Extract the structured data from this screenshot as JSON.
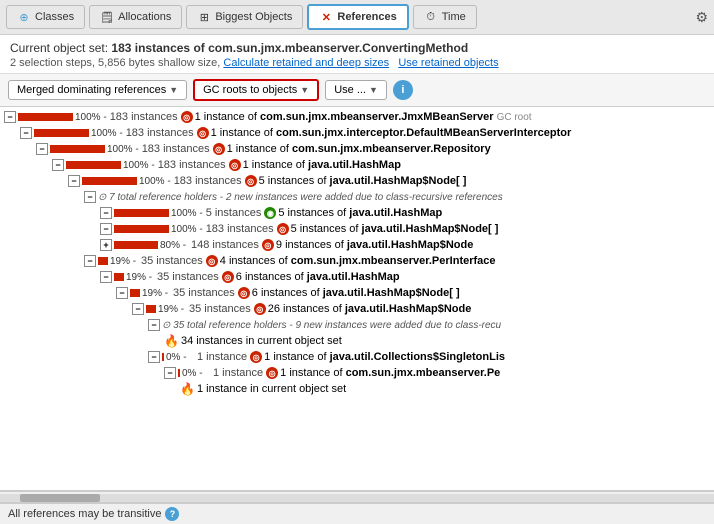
{
  "toolbar": {
    "tabs": [
      {
        "id": "classes",
        "label": "Classes",
        "icon": "⊕",
        "active": false
      },
      {
        "id": "allocations",
        "label": "Allocations",
        "icon": "📋",
        "active": false
      },
      {
        "id": "biggest-objects",
        "label": "Biggest Objects",
        "icon": "⊞",
        "active": false
      },
      {
        "id": "references",
        "label": "References",
        "icon": "✕",
        "active": true
      },
      {
        "id": "time",
        "label": "Time",
        "icon": "⏱",
        "active": false
      }
    ],
    "settings_label": "⚙"
  },
  "info_bar": {
    "prefix": "Current object set:",
    "description": "183 instances of com.sun.jmx.mbeanserver.ConvertingMethod",
    "subtitle": "2 selection steps, 5,856 bytes shallow size,",
    "link1": "Calculate retained and deep sizes",
    "link2": "Use retained objects"
  },
  "filter_bar": {
    "dropdown1_label": "Merged dominating references",
    "dropdown2_label": "GC roots to objects",
    "dropdown3_label": "Use ...",
    "info_label": "i"
  },
  "tree": {
    "rows": [
      {
        "indent": 0,
        "expand": "-",
        "bar_pct": 100,
        "pct_text": "100% -",
        "instances": "183 instances",
        "icon": "red",
        "icon_char": "◎",
        "text": "1 instance of ",
        "bold_text": "com.sun.jmx.mbeanserver.JmxMBeanServer",
        "badge": "GC root"
      },
      {
        "indent": 1,
        "expand": "-",
        "bar_pct": 100,
        "pct_text": "100% -",
        "instances": "183 instances",
        "icon": "red",
        "icon_char": "◎",
        "text": "1 instance of ",
        "bold_text": "com.sun.jmx.interceptor.DefaultMBeanServerInterceptor",
        "badge": ""
      },
      {
        "indent": 2,
        "expand": "-",
        "bar_pct": 100,
        "pct_text": "100% -",
        "instances": "183 instances",
        "icon": "red",
        "icon_char": "◎",
        "text": "1 instance of ",
        "bold_text": "com.sun.jmx.mbeanserver.Repository",
        "badge": ""
      },
      {
        "indent": 3,
        "expand": "-",
        "bar_pct": 100,
        "pct_text": "100% -",
        "instances": "183 instances",
        "icon": "red",
        "icon_char": "◎",
        "text": "1 instance of ",
        "bold_text": "java.util.HashMap",
        "badge": ""
      },
      {
        "indent": 4,
        "expand": "-",
        "bar_pct": 100,
        "pct_text": "100% -",
        "instances": "183 instances",
        "icon": "red",
        "icon_char": "◎",
        "text": "5 instances of ",
        "bold_text": "java.util.HashMap$Node[ ]",
        "badge": ""
      },
      {
        "indent": 5,
        "expand": "-",
        "bar_pct": 0,
        "special": true,
        "text": "7 total reference holders - 2 new instances were added due to class-recursive references",
        "badge": ""
      },
      {
        "indent": 6,
        "expand": "-",
        "bar_pct": 100,
        "pct_text": "100% -",
        "instances": "5 instances",
        "icon": "green",
        "icon_char": "◉",
        "text": "5 instances of ",
        "bold_text": "java.util.HashMap",
        "badge": ""
      },
      {
        "indent": 6,
        "expand": "-",
        "bar_pct": 100,
        "pct_text": "100% -",
        "instances": "183 instances",
        "icon": "red",
        "icon_char": "◎",
        "text": "5 instances of ",
        "bold_text": "java.util.HashMap$Node[ ]",
        "badge": ""
      },
      {
        "indent": 6,
        "expand": "+",
        "bar_pct": 80,
        "pct_text": "80% -",
        "instances": "148 instances",
        "icon": "red",
        "icon_char": "◎",
        "text": "9 instances of ",
        "bold_text": "java.util.HashMap$Node",
        "badge": ""
      },
      {
        "indent": 5,
        "expand": "-",
        "bar_pct": 19,
        "pct_text": "19% -",
        "instances": "35 instances",
        "icon": "red",
        "icon_char": "◎",
        "text": "4 instances of ",
        "bold_text": "com.sun.jmx.mbeanserver.PerInterface",
        "badge": ""
      },
      {
        "indent": 6,
        "expand": "-",
        "bar_pct": 19,
        "pct_text": "19% -",
        "instances": "35 instances",
        "icon": "red",
        "icon_char": "◎",
        "text": "6 instances of ",
        "bold_text": "java.util.HashMap",
        "badge": ""
      },
      {
        "indent": 7,
        "expand": "-",
        "bar_pct": 19,
        "pct_text": "19% -",
        "instances": "35 instances",
        "icon": "red",
        "icon_char": "◎",
        "text": "6 instances of ",
        "bold_text": "java.util.HashMap$Node[ ]",
        "badge": ""
      },
      {
        "indent": 8,
        "expand": "-",
        "bar_pct": 19,
        "pct_text": "19% -",
        "instances": "35 instances",
        "icon": "red",
        "icon_char": "◎",
        "text": "26 instances of ",
        "bold_text": "java.util.HashMap$Node",
        "badge": ""
      },
      {
        "indent": 9,
        "expand": "-",
        "bar_pct": 0,
        "special": true,
        "text": "35 total reference holders - 9 new instances were added due to class-recu",
        "badge": ""
      },
      {
        "indent": 10,
        "expand": null,
        "fire": true,
        "text": "34 instances in current object set",
        "badge": ""
      },
      {
        "indent": 9,
        "expand": "-",
        "bar_pct": 0,
        "pct_text": "0% -",
        "instances": "1 instance",
        "icon": "red",
        "icon_char": "◎",
        "text": "1 instance of ",
        "bold_text": "java.util.Collections$SingletonLis",
        "badge": ""
      },
      {
        "indent": 10,
        "expand": "-",
        "bar_pct": 0,
        "pct_text": "0% -",
        "instances": "1 instance",
        "icon": "red",
        "icon_char": "◎",
        "text": "1 instance of ",
        "bold_text": "com.sun.jmx.mbeanserver.Pe",
        "badge": ""
      },
      {
        "indent": 11,
        "expand": null,
        "fire": true,
        "text": "1 instance in current object set",
        "badge": ""
      }
    ]
  },
  "status_bar": {
    "text": "All references may be transitive"
  }
}
